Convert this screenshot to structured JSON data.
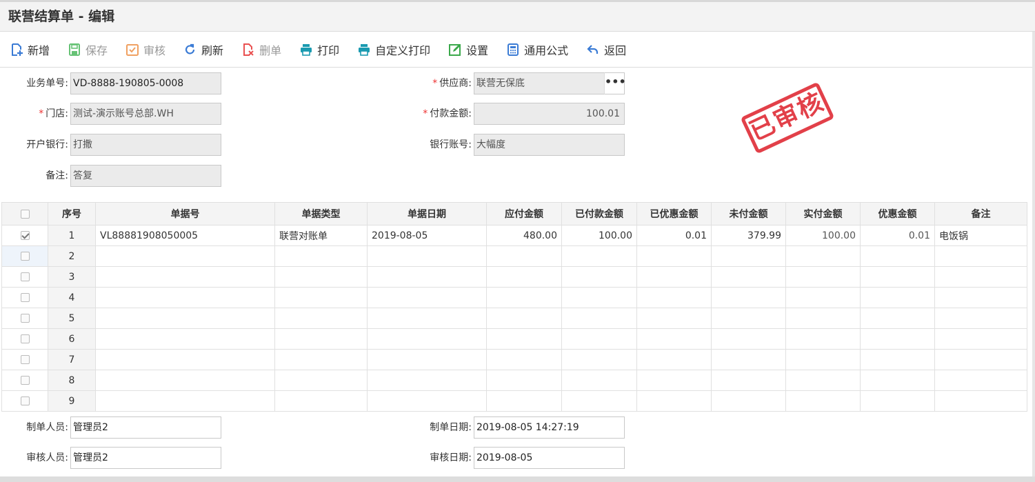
{
  "title": "联营结算单 - 编辑",
  "toolbar": [
    {
      "label": "新增",
      "icon": "add-doc-icon",
      "disabled": false
    },
    {
      "label": "保存",
      "icon": "save-icon",
      "disabled": true
    },
    {
      "label": "审核",
      "icon": "audit-icon",
      "disabled": true
    },
    {
      "label": "刷新",
      "icon": "refresh-icon",
      "disabled": false
    },
    {
      "label": "删单",
      "icon": "delete-doc-icon",
      "disabled": true
    },
    {
      "label": "打印",
      "icon": "print-icon",
      "disabled": false
    },
    {
      "label": "自定义打印",
      "icon": "custom-print-icon",
      "disabled": false
    },
    {
      "label": "设置",
      "icon": "settings-icon",
      "disabled": false
    },
    {
      "label": "通用公式",
      "icon": "calculator-icon",
      "disabled": false
    },
    {
      "label": "返回",
      "icon": "back-icon",
      "disabled": false
    }
  ],
  "form": {
    "bill_no_label": "业务单号:",
    "bill_no": "VD-8888-190805-0008",
    "supplier_label": "供应商:",
    "supplier": "联营无保底",
    "supplier_more": "•••",
    "store_label": "门店:",
    "store": "测试-演示账号总部.WH",
    "amount_label": "付款金额:",
    "amount": "100.01",
    "bank_label": "开户银行:",
    "bank": "打撒",
    "account_label": "银行账号:",
    "account": "大幅度",
    "remark_label": "备注:",
    "remark": "答复",
    "required_mark": "*"
  },
  "stamp": "已审核",
  "grid": {
    "headers": [
      "序号",
      "单据号",
      "单据类型",
      "单据日期",
      "应付金额",
      "已付款金额",
      "已优惠金额",
      "未付金额",
      "实付金额",
      "优惠金额",
      "备注"
    ],
    "rows": [
      {
        "seq": "1",
        "doc_no": "VL88881908050005",
        "doc_type": "联营对账单",
        "date": "2019-08-05",
        "payable": "480.00",
        "paid": "100.00",
        "discounted": "0.01",
        "unpaid": "379.99",
        "actual": "100.00",
        "discount": "0.01",
        "remark": "电饭锅",
        "checked": true
      },
      {
        "seq": "2"
      },
      {
        "seq": "3"
      },
      {
        "seq": "4"
      },
      {
        "seq": "5"
      },
      {
        "seq": "6"
      },
      {
        "seq": "7"
      },
      {
        "seq": "8"
      },
      {
        "seq": "9"
      }
    ]
  },
  "footer": {
    "maker_label": "制单人员:",
    "maker": "管理员2",
    "make_date_label": "制单日期:",
    "make_date": "2019-08-05 14:27:19",
    "auditor_label": "审核人员:",
    "auditor": "管理员2",
    "audit_date_label": "审核日期:",
    "audit_date": "2019-08-05"
  },
  "colors": {
    "blue_icon": "#3a7bd5",
    "green_icon": "#3aa84a",
    "teal_icon": "#1a9ab0",
    "orange_icon": "#f0a060",
    "red_icon": "#e95050",
    "stamp_red": "#e0303a"
  }
}
